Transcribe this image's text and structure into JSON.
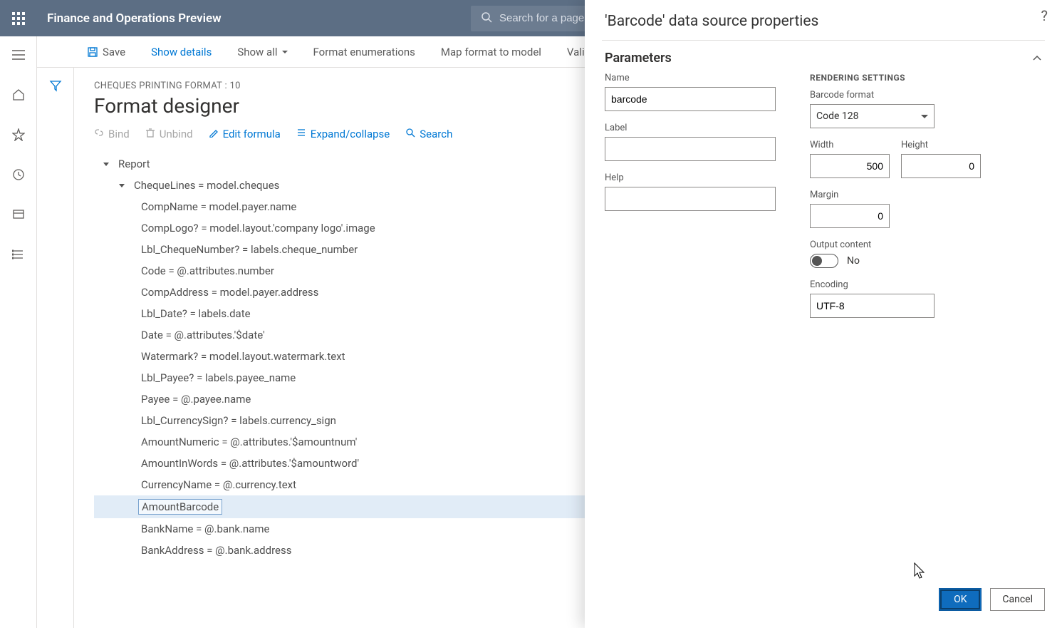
{
  "header": {
    "app_title": "Finance and Operations Preview",
    "search_placeholder": "Search for a page"
  },
  "cmd": {
    "save": "Save",
    "show_details": "Show details",
    "show_all": "Show all",
    "format_enum": "Format enumerations",
    "map_format": "Map format to model",
    "validate": "Vali"
  },
  "page": {
    "breadcrumb": "CHEQUES PRINTING FORMAT : 10",
    "title": "Format designer"
  },
  "actions": {
    "bind": "Bind",
    "unbind": "Unbind",
    "edit_formula": "Edit formula",
    "expand": "Expand/collapse",
    "search": "Search"
  },
  "tree": {
    "root": "Report",
    "lines": "ChequeLines = model.cheques",
    "items": [
      "CompName = model.payer.name",
      "CompLogo? = model.layout.'company logo'.image",
      "Lbl_ChequeNumber? = labels.cheque_number",
      "Code = @.attributes.number",
      "CompAddress = model.payer.address",
      "Lbl_Date? = labels.date",
      "Date = @.attributes.'$date'",
      "Watermark? = model.layout.watermark.text",
      "Lbl_Payee? = labels.payee_name",
      "Payee = @.payee.name",
      "Lbl_CurrencySign? = labels.currency_sign",
      "AmountNumeric = @.attributes.'$amountnum'",
      "AmountInWords = @.attributes.'$amountword'",
      "CurrencyName = @.currency.text",
      "AmountBarcode",
      "BankName = @.bank.name",
      "BankAddress = @.bank.address"
    ],
    "selected_index": 14
  },
  "panel": {
    "title": "'Barcode' data source properties",
    "section": "Parameters",
    "left": {
      "name_label": "Name",
      "name_value": "barcode",
      "label_label": "Label",
      "label_value": "",
      "help_label": "Help",
      "help_value": ""
    },
    "right": {
      "heading": "RENDERING SETTINGS",
      "format_label": "Barcode format",
      "format_value": "Code 128",
      "width_label": "Width",
      "width_value": "500",
      "height_label": "Height",
      "height_value": "0",
      "margin_label": "Margin",
      "margin_value": "0",
      "output_label": "Output content",
      "output_value": "No",
      "encoding_label": "Encoding",
      "encoding_value": "UTF-8"
    },
    "ok": "OK",
    "cancel": "Cancel"
  }
}
